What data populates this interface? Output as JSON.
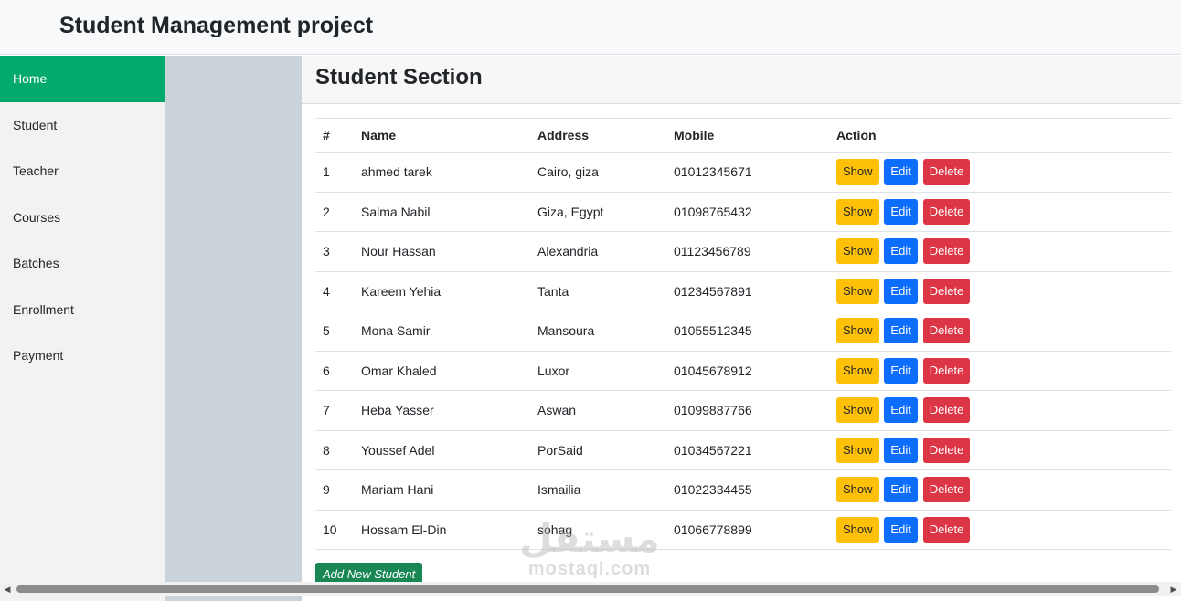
{
  "app": {
    "title": "Student Management project"
  },
  "sidebar": {
    "items": [
      {
        "label": "Home"
      },
      {
        "label": "Student"
      },
      {
        "label": "Teacher"
      },
      {
        "label": "Courses"
      },
      {
        "label": "Batches"
      },
      {
        "label": "Enrollment"
      },
      {
        "label": "Payment"
      }
    ]
  },
  "section": {
    "title": "Student Section"
  },
  "table": {
    "headers": [
      "#",
      "Name",
      "Address",
      "Mobile",
      "Action"
    ],
    "rows": [
      {
        "num": "1",
        "name": "ahmed tarek",
        "address": "Cairo, giza",
        "mobile": "01012345671"
      },
      {
        "num": "2",
        "name": "Salma Nabil",
        "address": "Giza, Egypt",
        "mobile": "01098765432"
      },
      {
        "num": "3",
        "name": "Nour Hassan",
        "address": "Alexandria",
        "mobile": "01123456789"
      },
      {
        "num": "4",
        "name": "Kareem Yehia",
        "address": "Tanta",
        "mobile": "01234567891"
      },
      {
        "num": "5",
        "name": "Mona Samir",
        "address": "Mansoura",
        "mobile": "01055512345"
      },
      {
        "num": "6",
        "name": "Omar Khaled",
        "address": "Luxor",
        "mobile": "01045678912"
      },
      {
        "num": "7",
        "name": "Heba Yasser",
        "address": "Aswan",
        "mobile": "01099887766"
      },
      {
        "num": "8",
        "name": "Youssef Adel",
        "address": "PorSaid",
        "mobile": "01034567221"
      },
      {
        "num": "9",
        "name": "Mariam Hani",
        "address": "Ismailia",
        "mobile": "01022334455"
      },
      {
        "num": "10",
        "name": "Hossam El-Din",
        "address": "sohag",
        "mobile": "01066778899"
      }
    ],
    "actions": {
      "show": "Show",
      "edit": "Edit",
      "delete": "Delete"
    }
  },
  "add_button": {
    "label": "Add New Student"
  },
  "watermark": {
    "arabic": "مستقل",
    "latin": "mostaql.com"
  },
  "colors": {
    "nav_active": "#04aa6d",
    "show": "#ffc107",
    "edit": "#0d6efd",
    "delete": "#dc3545",
    "add": "#198754"
  }
}
